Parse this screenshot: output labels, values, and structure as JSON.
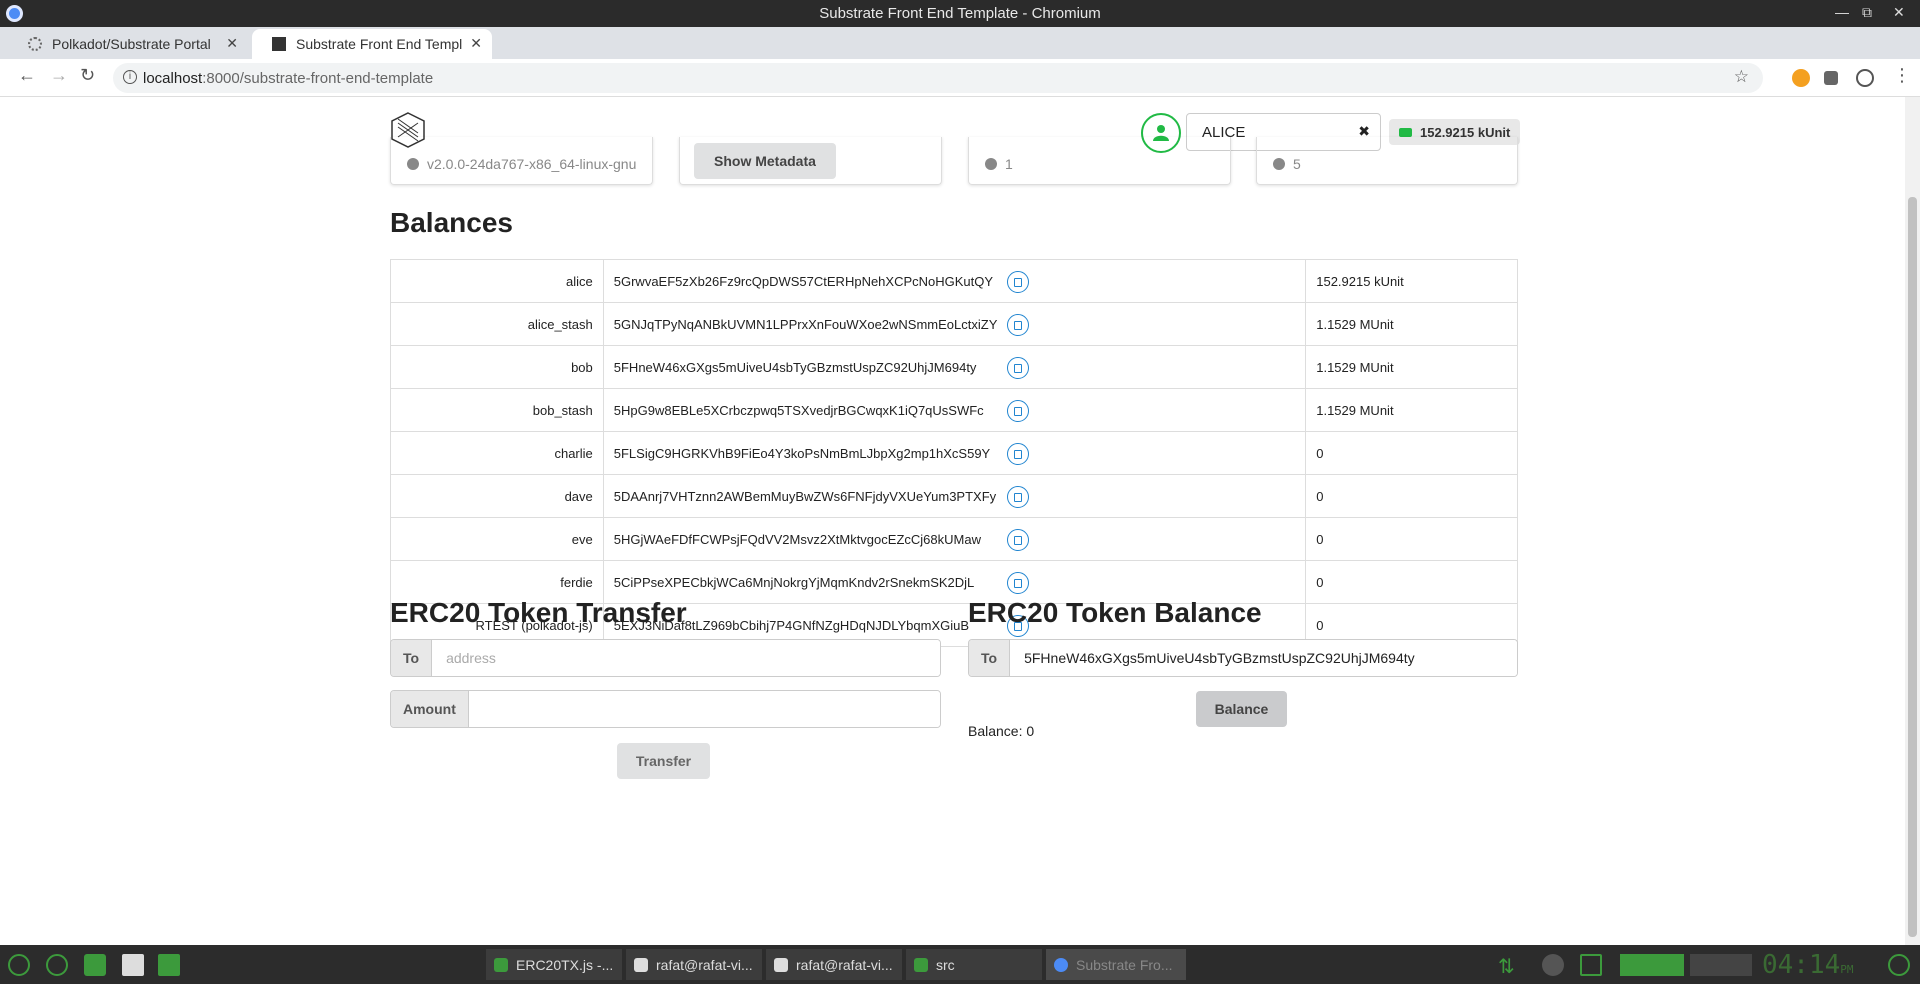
{
  "window": {
    "title": "Substrate Front End Template - Chromium"
  },
  "tabs": [
    {
      "label": "Polkadot/Substrate Portal"
    },
    {
      "label": "Substrate Front End Templ"
    }
  ],
  "address_bar": {
    "host": "localhost",
    "path": ":8000/substrate-front-end-template"
  },
  "header": {
    "account": "ALICE",
    "balance": "152.9215 kUnit"
  },
  "cards": {
    "version": "v2.0.0-24da767-x86_64-linux-gnu",
    "show_metadata": "Show Metadata",
    "block1": "1",
    "block2": "5"
  },
  "balances": {
    "title": "Balances",
    "rows": [
      {
        "name": "alice",
        "address": "5GrwvaEF5zXb26Fz9rcQpDWS57CtERHpNehXCPcNoHGKutQY",
        "balance": "152.9215 kUnit"
      },
      {
        "name": "alice_stash",
        "address": "5GNJqTPyNqANBkUVMN1LPPrxXnFouWXoe2wNSmmEoLctxiZY",
        "balance": "1.1529 MUnit"
      },
      {
        "name": "bob",
        "address": "5FHneW46xGXgs5mUiveU4sbTyGBzmstUspZC92UhjJM694ty",
        "balance": "1.1529 MUnit"
      },
      {
        "name": "bob_stash",
        "address": "5HpG9w8EBLe5XCrbczpwq5TSXvedjrBGCwqxK1iQ7qUsSWFc",
        "balance": "1.1529 MUnit"
      },
      {
        "name": "charlie",
        "address": "5FLSigC9HGRKVhB9FiEo4Y3koPsNmBmLJbpXg2mp1hXcS59Y",
        "balance": "0"
      },
      {
        "name": "dave",
        "address": "5DAAnrj7VHTznn2AWBemMuyBwZWs6FNFjdyVXUeYum3PTXFy",
        "balance": "0"
      },
      {
        "name": "eve",
        "address": "5HGjWAeFDfFCWPsjFQdVV2Msvz2XtMktvgocEZcCj68kUMaw",
        "balance": "0"
      },
      {
        "name": "ferdie",
        "address": "5CiPPseXPECbkjWCa6MnjNokrgYjMqmKndv2rSnekmSK2DjL",
        "balance": "0"
      },
      {
        "name": "RTEST (polkadot-js)",
        "address": "5EXJ3NiDaf8tLZ969bCbihj7P4GNfNZgHDqNJDLYbqmXGiuB",
        "balance": "0"
      }
    ]
  },
  "transfer": {
    "title": "ERC20 Token Transfer",
    "to_label": "To",
    "to_placeholder": "address",
    "amount_label": "Amount",
    "button": "Transfer"
  },
  "token_balance": {
    "title": "ERC20 Token Balance",
    "to_label": "To",
    "to_value": "5FHneW46xGXgs5mUiveU4sbTyGBzmstUspZC92UhjJM694ty",
    "button": "Balance",
    "result": "Balance: 0"
  },
  "taskbar": {
    "tasks": [
      {
        "label": "ERC20TX.js -..."
      },
      {
        "label": "rafat@rafat-vi..."
      },
      {
        "label": "rafat@rafat-vi..."
      },
      {
        "label": "src"
      },
      {
        "label": "Substrate Fro..."
      }
    ],
    "clock": "04:14",
    "ampm": "PM"
  },
  "colors": {
    "accent": "#2185d0",
    "positive": "#21ba45"
  }
}
